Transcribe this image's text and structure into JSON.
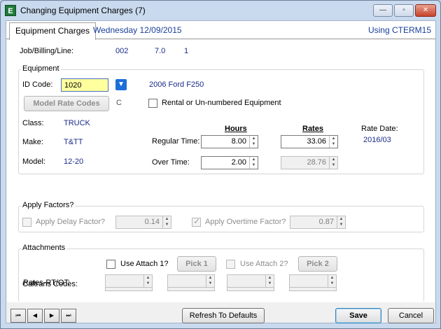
{
  "window": {
    "title": "Changing Equipment Charges  (7)",
    "app_icon_letter": "E",
    "minimize": "—",
    "maximize": "▫",
    "close": "✕"
  },
  "tabs": {
    "active_label": "Equipment Charges",
    "date": "Wednesday 12/09/2015",
    "using": "Using CTERM15"
  },
  "job": {
    "label": "Job/Billing/Line:",
    "job": "002",
    "billing": "7.0",
    "line": "1"
  },
  "equipment": {
    "group_label": "Equipment",
    "id_code_label": "ID Code:",
    "id_code_value": "1020",
    "description": "2006 Ford F250",
    "model_rate_codes_label": "Model Rate Codes",
    "rate_code_letter": "C",
    "rental_label": "Rental or Un-numbered Equipment",
    "class_label": "Class:",
    "class_value": "TRUCK",
    "make_label": "Make:",
    "make_value": "T&TT",
    "model_label": "Model:",
    "model_value": "12-20",
    "hours_header": "Hours",
    "rates_header": "Rates",
    "regular_time_label": "Regular Time:",
    "regular_hours": "8.00",
    "regular_rate": "33.06",
    "over_time_label": "Over Time:",
    "over_hours": "2.00",
    "over_rate": "28.76",
    "rate_date_label": "Rate Date:",
    "rate_date_value": "2016/03"
  },
  "factors": {
    "group_label": "Apply Factors?",
    "delay_label": "Apply Delay Factor?",
    "delay_value": "0.14",
    "overtime_label": "Apply Overtime Factor?",
    "overtime_value": "0.87",
    "overtime_checked": true
  },
  "attachments": {
    "group_label": "Attachments",
    "use_attach1_label": "Use Attach 1?",
    "pick1_label": "Pick 1",
    "use_attach2_label": "Use Attach 2?",
    "pick2_label": "Pick 2",
    "caltrans_label": "Caltrans Codes:",
    "rates_label": "Rates-RT/OT:"
  },
  "footer": {
    "refresh_label": "Refresh To Defaults",
    "save_label": "Save",
    "cancel_label": "Cancel"
  }
}
